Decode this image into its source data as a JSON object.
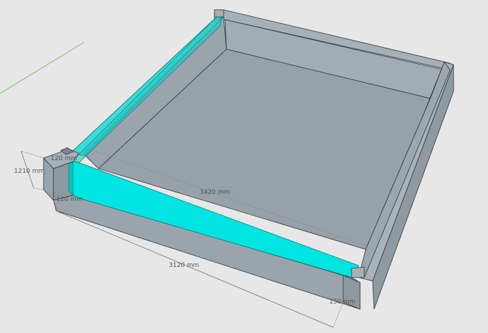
{
  "dimensions": {
    "height": "1210 mm",
    "inner_length": "3420 mm",
    "outer_length": "3120 mm",
    "slot_top": "120 mm",
    "wall_thickness": "120 mm",
    "slot_right": "150 mm"
  },
  "colors": {
    "background": "#e7e7e7",
    "concrete_top": "#a3adb5",
    "concrete_side": "#9aa4ac",
    "concrete_dark": "#8e98a0",
    "floor": "#98a2aa",
    "glass": "#00e5e1",
    "axis_green": "#7fbf6a"
  }
}
